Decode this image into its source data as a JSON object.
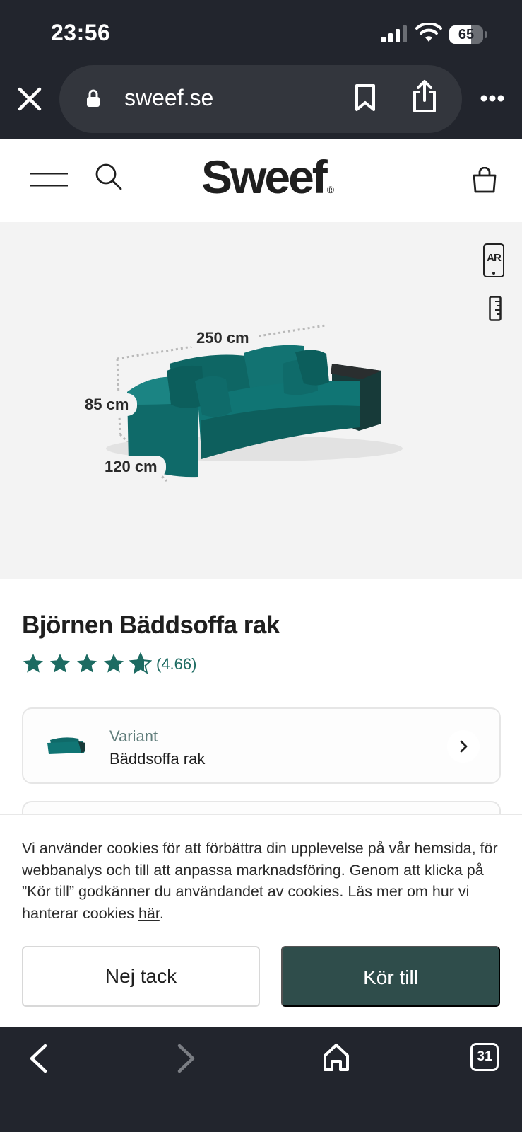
{
  "status_bar": {
    "time": "23:56",
    "battery_level": "65",
    "battery_fraction": 0.65,
    "icons": [
      "signal-icon",
      "wifi-icon",
      "battery-icon"
    ]
  },
  "browser": {
    "url": "sweef.se",
    "icons": [
      "close-icon",
      "lock-icon",
      "bookmark-icon",
      "share-icon",
      "more-icon"
    ]
  },
  "site_header": {
    "logo_text": "Sweef",
    "logo_mark": "®",
    "icons": [
      "menu-icon",
      "search-icon",
      "cart-icon"
    ]
  },
  "product_image": {
    "ar_label": "AR",
    "dimensions": {
      "width": "250 cm",
      "height": "85 cm",
      "depth": "120 cm"
    },
    "sofa_color": "#0f6f6c"
  },
  "product": {
    "title": "Björnen Bäddsoffa rak",
    "rating": 4.66,
    "rating_text": "(4.66)",
    "star_color": "#1d6b62"
  },
  "variant": {
    "label": "Variant",
    "value": "Bäddsoffa rak"
  },
  "cookie": {
    "text_before_link": "Vi använder cookies för att förbättra din upplevelse på vår hemsida, för webbanalys och till att anpassa marknadsföring. Genom att klicka på ”Kör till” godkänner du användandet av cookies. Läs mer om hur vi hanterar cookies ",
    "link_text": "här",
    "text_after_link": ".",
    "decline_label": "Nej tack",
    "accept_label": "Kör till",
    "accept_color": "#2f4d4b"
  },
  "bottom_bar": {
    "tab_count": "31",
    "icons": [
      "back-icon",
      "forward-icon",
      "home-icon",
      "tabs-icon"
    ]
  }
}
